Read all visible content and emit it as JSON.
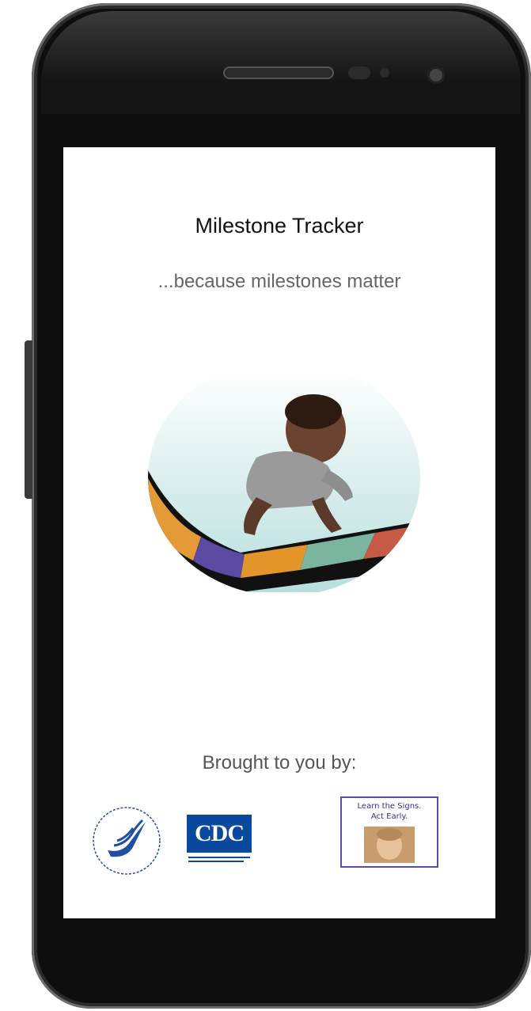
{
  "app": {
    "title": "Milestone Tracker",
    "tagline": "...because milestones matter"
  },
  "sponsors": {
    "heading": "Brought to you by:",
    "cdc_logo_text": "CDC",
    "campaign_line1": "Learn the Signs.",
    "campaign_line2": "Act Early."
  },
  "colors": {
    "cdc_blue": "#0a4a9e",
    "campaign_purple": "#5b4aa6",
    "tile_orange": "#e39a37",
    "tile_purple": "#5a4aa1",
    "tile_teal": "#7bb5a0",
    "tile_red": "#c75a45"
  }
}
